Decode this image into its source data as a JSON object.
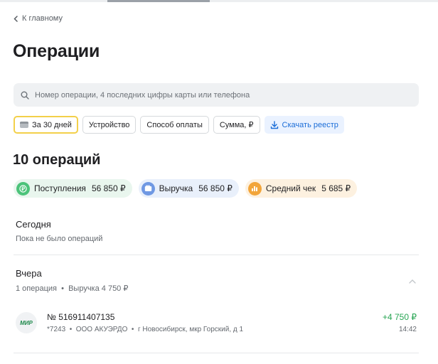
{
  "nav": {
    "back_label": "К главному"
  },
  "page": {
    "title": "Операции"
  },
  "search": {
    "placeholder": "Номер операции, 4 последних цифры карты или телефона"
  },
  "filters": {
    "period": "За 30 дней",
    "device": "Устройство",
    "payment_method": "Способ оплаты",
    "amount": "Сумма, ₽",
    "download": "Скачать реестр"
  },
  "summary": {
    "count": "10 операций",
    "income": {
      "label": "Поступления",
      "value": "56 850 ₽"
    },
    "revenue": {
      "label": "Выручка",
      "value": "56 850 ₽"
    },
    "avg_check": {
      "label": "Средний чек",
      "value": "5 685 ₽"
    }
  },
  "groups": [
    {
      "title": "Сегодня",
      "subtitle": "Пока не было операций"
    },
    {
      "title": "Вчера",
      "subtitle": "1 операция  •  Выручка 4 750 ₽",
      "operations": [
        {
          "card_logo": "МИР",
          "number": "№ 516911407135",
          "meta": "*7243  •  ООО АКУЭРДО  •  г Новосибирск, мкр Горский, д 1",
          "amount": "+4 750 ₽",
          "time": "14:42"
        }
      ]
    }
  ],
  "colors": {
    "accent_yellow": "#f3d04a",
    "link_blue": "#1c6ed8",
    "positive_green": "#27a553"
  }
}
